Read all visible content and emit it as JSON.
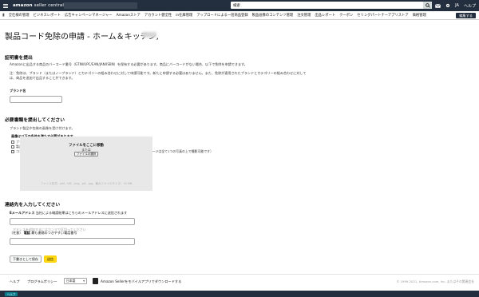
{
  "topbar": {
    "logo_bold": "amazon",
    "logo_rest": "seller central",
    "search_value": "検索",
    "lang": "JA",
    "help": "ヘルプ"
  },
  "nav": {
    "items": [
      "全仕様の管理",
      "ビジネスレポート",
      "広告キャンペーンマネージャー",
      "Amazonストア",
      "アカウント健全性",
      "in在庫管理",
      "アップロードによる一括商品登録",
      "製品画像のコンテンツ管理",
      "注文管理",
      "出品レポート",
      "クーポン",
      "セリングパートナーアプリストア",
      "価格管理"
    ],
    "edit_label": "編集する"
  },
  "main": {
    "title": "製品コード免除の申請 - ホーム＆キッチン,",
    "proof": {
      "heading": "証明書を提出",
      "p1": "Amazonに出品する商品のバーコード番号（GTIN/UPC/EAN/JAN/ISBN）を保有する必要があります。商品にバーコードがない場合、以下で免除を申請できます。",
      "p2a": "注：免除は、ブランド（またはノーブランド）とカテゴリーの組み合わせに対して申請可能です。新たに申請する必要はありません。また、免除が適用されたブランドとカテゴリーの組み合わせに対して",
      "p2b": "は、商品を追加で出品することができます。",
      "brand_label": "ブランド名",
      "brand_value": ""
    },
    "docs": {
      "heading": "必要書類を提出してください",
      "intro": "ブランド製品や包装の画像を受け付けます。",
      "criteria_heading": "画像は以下の条件を満たす必要があります。",
      "criteria": [
        "ブランド名",
        "製品とパッケージ全てのページにわたって表示されています",
        "コンピューターで合成されていない、または画像にデジタル的に追加されていない（製品とパッケージは全て1つの写真の上で撮影可能です）"
      ],
      "criteria_suffix": "と完全に一致",
      "upload_title": "ファイルをここに移動",
      "upload_or": "または",
      "upload_button": "ファイルの選択",
      "upload_hint": "ファイル形式：pdf、tiff、png、gif、jpg。最大ファイルサイズ：10 MB"
    },
    "contact": {
      "heading": "連絡先を入力してください",
      "email_label": "Eメールアドレス",
      "email_hint": "当社による確認結果はこちらのメールアドレスに送信されます",
      "email_placeholder": "アドレスを追加するにはカンマで区切ってください",
      "phone_label": "電話",
      "phone_optional": "（任意）",
      "phone_hint": "最も連絡のつきやすい電話番号",
      "phone_value": ""
    },
    "buttons": {
      "save_draft": "下書きとして保存",
      "submit": "送信"
    }
  },
  "footer": {
    "help": "ヘルプ",
    "policy": "プログラムポリシー",
    "language": "日本語",
    "app_text": "Amazon Sellerをモバイルアプリでダウンロードする",
    "copyright": "© 1999-2021, Amazon.com, Inc. またはその関連会社",
    "bar_pill": "ヘルプ"
  },
  "colors": {
    "topbar": "#232f3e",
    "primary_button": "#ffd814",
    "upload_area": "#e8e8e8"
  }
}
